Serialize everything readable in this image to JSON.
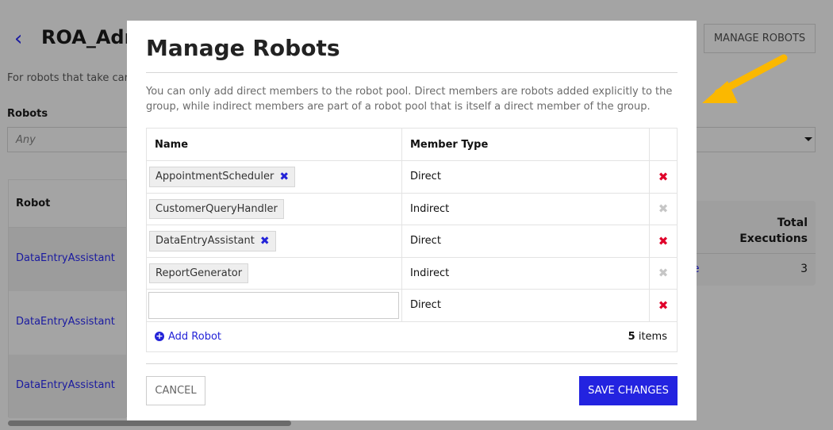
{
  "background": {
    "back_icon": "chevron-left-icon",
    "title": "ROA_Adm",
    "description": "For robots that take care",
    "robots_label": "Robots",
    "robots_placeholder": "Any",
    "manage_button": "MANAGE ROBOTS",
    "table_header": "Robot",
    "rows": [
      "DataEntryAssistant",
      "DataEntryAssistant",
      "DataEntryAssistant"
    ],
    "card_header": "Total Executions",
    "card_link": "e",
    "card_value": "3",
    "arrow_color": "#fbb800"
  },
  "modal": {
    "title": "Manage Robots",
    "description": "You can only add direct members to the robot pool. Direct members are robots added explicitly to the group, while indirect members are part of a robot pool that is itself a direct member of the group.",
    "columns": [
      "Name",
      "Member Type"
    ],
    "rows": [
      {
        "name": "AppointmentScheduler",
        "type": "Direct",
        "removable": true
      },
      {
        "name": "CustomerQueryHandler",
        "type": "Indirect",
        "removable": false
      },
      {
        "name": "DataEntryAssistant",
        "type": "Direct",
        "removable": true
      },
      {
        "name": "ReportGenerator",
        "type": "Indirect",
        "removable": false
      },
      {
        "name": "",
        "type": "Direct",
        "removable": true
      }
    ],
    "add_label": "Add Robot",
    "count": "5",
    "count_suffix": " items",
    "cancel": "CANCEL",
    "save": "SAVE CHANGES",
    "accent": "#2323e0",
    "delete_color": "#e0002a"
  }
}
